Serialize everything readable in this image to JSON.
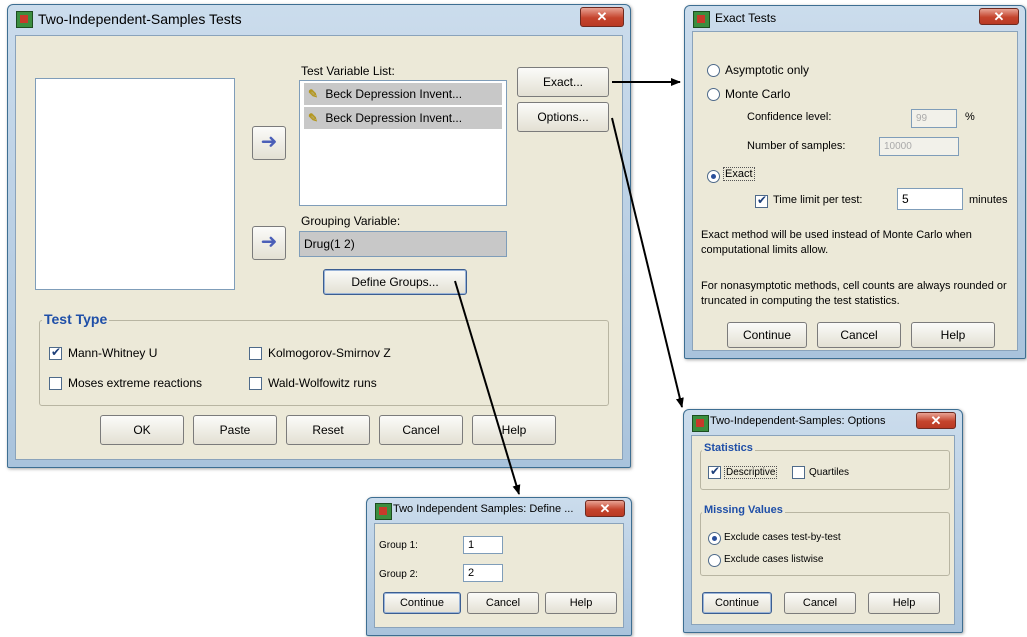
{
  "main_dialog": {
    "title": "Two-Independent-Samples Tests",
    "test_variable_label": "Test Variable List:",
    "test_variables": [
      "Beck Depression Invent...",
      "Beck Depression Invent..."
    ],
    "grouping_label": "Grouping Variable:",
    "grouping_value": "Drug(1 2)",
    "define_groups": "Define Groups...",
    "exact_button": "Exact...",
    "options_button": "Options...",
    "test_type_title": "Test Type",
    "mann_whitney": "Mann-Whitney U",
    "kolmogorov": "Kolmogorov-Smirnov Z",
    "moses": "Moses extreme reactions",
    "wald": "Wald-Wolfowitz runs",
    "ok": "OK",
    "paste": "Paste",
    "reset": "Reset",
    "cancel": "Cancel",
    "help": "Help"
  },
  "exact_dialog": {
    "title": "Exact Tests",
    "asymptotic": "Asymptotic only",
    "monte_carlo": "Monte Carlo",
    "confidence_label": "Confidence level:",
    "confidence_value": "99",
    "percent": "%",
    "samples_label": "Number of samples:",
    "samples_value": "10000",
    "exact": "Exact",
    "time_limit_label": "Time limit per test:",
    "time_limit_value": "5",
    "minutes": "minutes",
    "note1": "Exact method will be used instead of Monte Carlo when computational limits allow.",
    "note2": "For nonasymptotic methods, cell counts are always rounded or truncated in computing the test statistics.",
    "continue": "Continue",
    "cancel": "Cancel",
    "help": "Help"
  },
  "options_dialog": {
    "title": "Two-Independent-Samples: Options",
    "statistics_title": "Statistics",
    "descriptive": "Descriptive",
    "quartiles": "Quartiles",
    "missing_title": "Missing Values",
    "exclude_test": "Exclude cases test-by-test",
    "exclude_list": "Exclude cases listwise",
    "continue": "Continue",
    "cancel": "Cancel",
    "help": "Help"
  },
  "define_dialog": {
    "title": "Two Independent Samples: Define ...",
    "group1_label": "Group 1:",
    "group1_value": "1",
    "group2_label": "Group 2:",
    "group2_value": "2",
    "continue": "Continue",
    "cancel": "Cancel",
    "help": "Help"
  },
  "icons": {
    "app": "spss-app-icon",
    "close": "close-icon",
    "move_arrow": "arrow-left-icon",
    "scale_variable": "ruler-icon"
  }
}
